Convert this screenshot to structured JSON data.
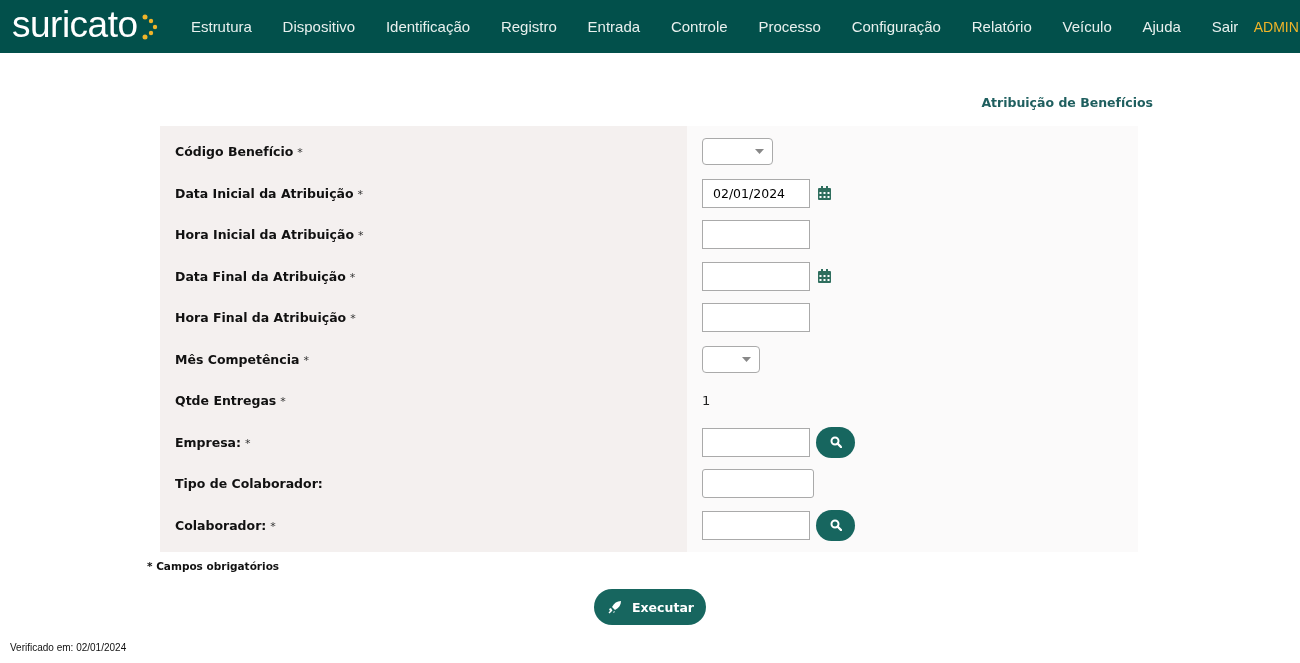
{
  "navbar": {
    "logo": "suricato",
    "menu": [
      "Estrutura",
      "Dispositivo",
      "Identificação",
      "Registro",
      "Entrada",
      "Controle",
      "Processo",
      "Configuração",
      "Relatório",
      "Veículo",
      "Ajuda",
      "Sair"
    ],
    "user": "ADMIN"
  },
  "page_title": "Atribuição de Benefícios",
  "form": {
    "fields": [
      {
        "label": "Código Benefício",
        "mark": "*",
        "kind": "select"
      },
      {
        "label": "Data Inicial da Atribuição",
        "mark": "*",
        "kind": "date",
        "value": "02/01/2024"
      },
      {
        "label": "Hora Inicial da Atribuição",
        "mark": "*",
        "kind": "text"
      },
      {
        "label": "Data Final da Atribuição",
        "mark": "*",
        "kind": "date"
      },
      {
        "label": "Hora Final da Atribuição",
        "mark": "*",
        "kind": "text"
      },
      {
        "label": "Mês Competência",
        "mark": "*",
        "kind": "select-small"
      },
      {
        "label": "Qtde Entregas",
        "mark": "*",
        "kind": "static",
        "value": "1"
      },
      {
        "label": "Empresa:",
        "mark": "*",
        "kind": "lookup"
      },
      {
        "label": "Tipo de Colaborador:",
        "kind": "text-wide"
      },
      {
        "label": "Colaborador:",
        "mark": "*",
        "kind": "lookup"
      }
    ]
  },
  "required_note": "* Campos obrigatórios",
  "submit_button": "Executar",
  "footer": "Verificado em: 02/01/2024"
}
